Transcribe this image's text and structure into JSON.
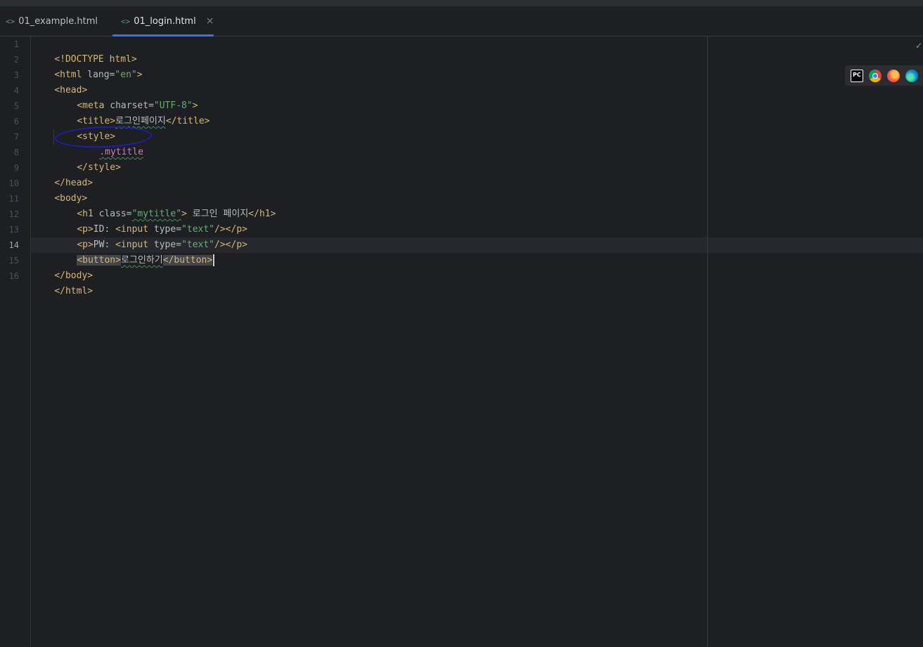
{
  "tabs": [
    {
      "label": "01_example.html",
      "icon": "html-file-icon",
      "active": false
    },
    {
      "label": "01_login.html",
      "icon": "html-file-icon",
      "active": true,
      "close": "×"
    }
  ],
  "tab_icon_glyph": "<>",
  "current_line": 14,
  "line_numbers": [
    "1",
    "2",
    "3",
    "4",
    "5",
    "6",
    "7",
    "8",
    "9",
    "10",
    "11",
    "12",
    "13",
    "14",
    "15",
    "16"
  ],
  "code": {
    "l1": {
      "a": "<!DOCTYPE html>"
    },
    "l2": {
      "a": "<html ",
      "b": "lang",
      "c": "=",
      "d": "\"en\"",
      "e": ">"
    },
    "l3": {
      "a": "<head>"
    },
    "l4": {
      "a": "<meta ",
      "b": "charset",
      "c": "=",
      "d": "\"UTF-8\"",
      "e": ">"
    },
    "l5": {
      "a": "<title>",
      "b": "로그인페이지",
      "c": "</title>"
    },
    "l6": {
      "a": "<style>"
    },
    "l7": {
      "a": ".mytitle"
    },
    "l8": {
      "a": "</style>"
    },
    "l9": {
      "a": "</head>"
    },
    "l10": {
      "a": "<body>"
    },
    "l11": {
      "a": "<h1 ",
      "b": "class",
      "c": "=",
      "d": "\"mytitle\"",
      "e": ">",
      "f": " 로그인 페이지",
      "g": "</h1>"
    },
    "l12": {
      "a": "<p>",
      "b": "ID: ",
      "c": "<input ",
      "d": "type",
      "e": "=",
      "f": "\"text\"",
      "g": "/></p>"
    },
    "l13": {
      "a": "<p>",
      "b": "PW: ",
      "c": "<input ",
      "d": "type",
      "e": "=",
      "f": "\"text\"",
      "g": "/></p>"
    },
    "l14": {
      "a": "<button>",
      "b": "로그인하기",
      "c": "</button>"
    },
    "l15": {
      "a": "</body>"
    },
    "l16": {
      "a": "</html>"
    }
  },
  "annotation": {
    "color": "#1b1fb8"
  },
  "browsers": [
    "pycharm-icon",
    "chrome-icon",
    "firefox-icon",
    "edge-icon"
  ],
  "pycharm_label": "PC",
  "inspection_status": "✓",
  "colors": {
    "background": "#1e1f22",
    "tag": "#d5b778",
    "attr_value": "#6aab73",
    "accent": "#3574f0"
  }
}
